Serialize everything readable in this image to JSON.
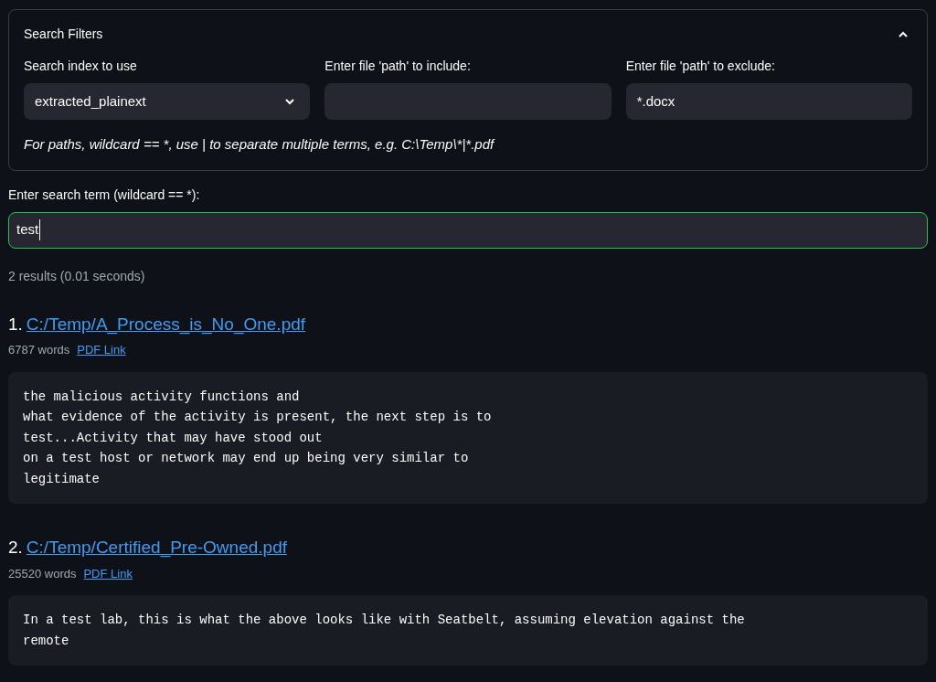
{
  "filters": {
    "title": "Search Filters",
    "expanded": true,
    "index_select": {
      "label": "Search index to use",
      "value": "extracted_plainext"
    },
    "include_field": {
      "label": "Enter file 'path' to include:"
    },
    "exclude_field": {
      "label": "Enter file 'path' to exclude:",
      "value": "*.docx"
    },
    "hint": "For paths, wildcard == *, use | to separate multiple terms, e.g. C:\\Temp\\*|*.pdf"
  },
  "search_field": {
    "label": "Enter search term (wildcard == *):",
    "value": "test",
    "focused": true
  },
  "result_count": "2 results (0.01 seconds)",
  "results": [
    {
      "number": "1.",
      "path": "C:/Temp/A_Process_is_No_One.pdf",
      "words": "6787 words",
      "link": "PDF Link",
      "snippet": [
        "the malicious activity functions and",
        "what evidence of the activity is present, the next step is to",
        "test...Activity that may have stood out",
        "on a test host or network may end up being very similar to",
        "legitimate"
      ]
    },
    {
      "number": "2.",
      "path": "C:/Temp/Certified_Pre-Owned.pdf",
      "words": "25520 words",
      "link": "PDF Link",
      "snippet": [
        "In a test lab, this is what the above looks like with Seatbelt, assuming elevation against the",
        "remote"
      ]
    }
  ]
}
